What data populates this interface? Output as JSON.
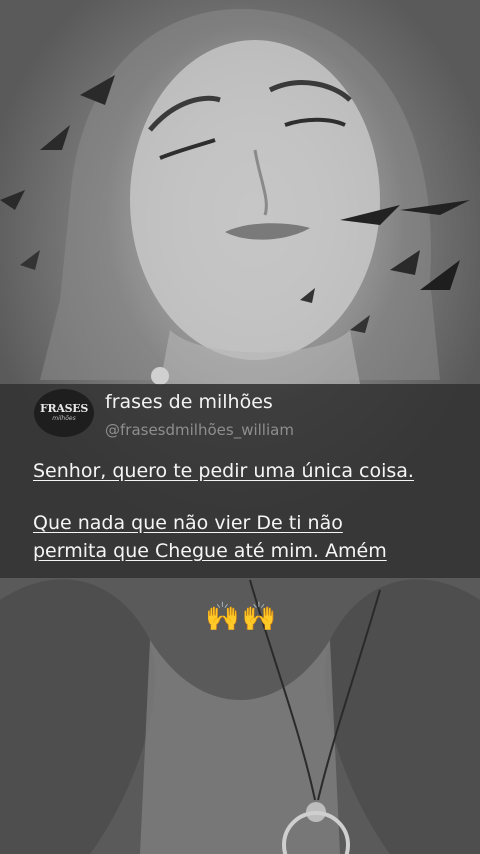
{
  "post": {
    "avatar_text": "FRASES",
    "avatar_subtext": "milhões",
    "display_name": "frases de milhões",
    "handle": "@frasesdmilhões_william",
    "quote_line_1": "Senhor, quero te pedir uma única coisa.",
    "quote_line_2": "Que nada que não vier De ti não",
    "quote_line_3": "permita que Chegue até mim. Amém",
    "emoji": "🙌🙌"
  },
  "colors": {
    "card_background": "#303030",
    "text_primary": "#f5f5f5",
    "text_secondary": "#8e8e8e"
  }
}
